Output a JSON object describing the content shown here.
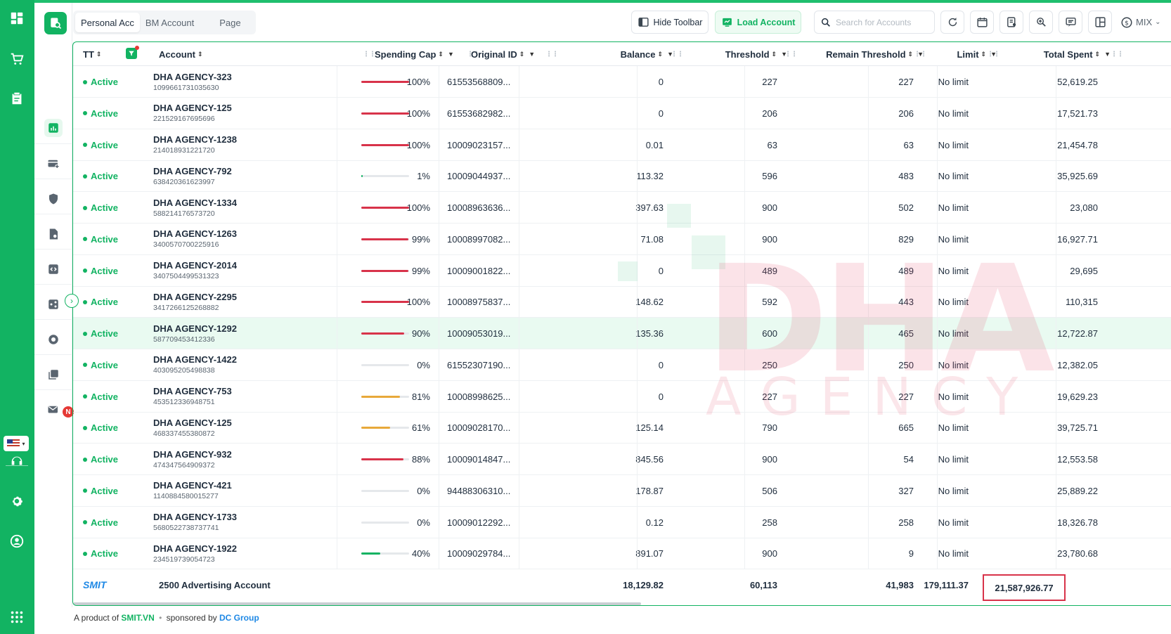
{
  "header": {
    "tabs": [
      "Personal Acc",
      "BM Account",
      "Page"
    ],
    "hide_toolbar": "Hide Toolbar",
    "load_account": "Load Account",
    "search_placeholder": "Search for Accounts",
    "currency": "MIX"
  },
  "columns": {
    "tt": "TT",
    "account": "Account",
    "spending_cap": "Spending Cap",
    "original_id": "Original ID",
    "balance": "Balance",
    "threshold": "Threshold",
    "remain_threshold": "Remain Threshold",
    "limit": "Limit",
    "total_spent": "Total Spent"
  },
  "colors": {
    "accent": "#12b362",
    "red": "#d8334a",
    "amber": "#e8a93a"
  },
  "rows": [
    {
      "status": "Active",
      "name": "DHA AGENCY-323",
      "id": "1099661731035630",
      "cap_pct": "100%",
      "cap_frac": 1.0,
      "cap_color": "red",
      "orig": "61553568809...",
      "balance": "0",
      "threshold": "227",
      "remain": "227",
      "limit": "No limit",
      "spent": "52,619.25"
    },
    {
      "status": "Active",
      "name": "DHA AGENCY-125",
      "id": "221529167695696",
      "cap_pct": "100%",
      "cap_frac": 1.0,
      "cap_color": "red",
      "orig": "61553682982...",
      "balance": "0",
      "threshold": "206",
      "remain": "206",
      "limit": "No limit",
      "spent": "17,521.73"
    },
    {
      "status": "Active",
      "name": "DHA AGENCY-1238",
      "id": "214018931221720",
      "cap_pct": "100%",
      "cap_frac": 1.0,
      "cap_color": "red",
      "orig": "10009023157...",
      "balance": "0.01",
      "threshold": "63",
      "remain": "63",
      "limit": "No limit",
      "spent": "21,454.78"
    },
    {
      "status": "Active",
      "name": "DHA AGENCY-792",
      "id": "638420361623997",
      "cap_pct": "1%",
      "cap_frac": 0.03,
      "cap_color": "green",
      "orig": "10009044937...",
      "balance": "113.32",
      "threshold": "596",
      "remain": "483",
      "limit": "No limit",
      "spent": "35,925.69"
    },
    {
      "status": "Active",
      "name": "DHA AGENCY-1334",
      "id": "588214176573720",
      "cap_pct": "100%",
      "cap_frac": 1.0,
      "cap_color": "red",
      "orig": "10008963636...",
      "balance": "397.63",
      "threshold": "900",
      "remain": "502",
      "limit": "No limit",
      "spent": "23,080"
    },
    {
      "status": "Active",
      "name": "DHA AGENCY-1263",
      "id": "3400570700225916",
      "cap_pct": "99%",
      "cap_frac": 0.99,
      "cap_color": "red",
      "orig": "10008997082...",
      "balance": "71.08",
      "threshold": "900",
      "remain": "829",
      "limit": "No limit",
      "spent": "16,927.71"
    },
    {
      "status": "Active",
      "name": "DHA AGENCY-2014",
      "id": "3407504499531323",
      "cap_pct": "99%",
      "cap_frac": 0.99,
      "cap_color": "red",
      "orig": "10009001822...",
      "balance": "0",
      "threshold": "489",
      "remain": "489",
      "limit": "No limit",
      "spent": "29,695"
    },
    {
      "status": "Active",
      "name": "DHA AGENCY-2295",
      "id": "3417266125268882",
      "cap_pct": "100%",
      "cap_frac": 1.0,
      "cap_color": "red",
      "orig": "10008975837...",
      "balance": "148.62",
      "threshold": "592",
      "remain": "443",
      "limit": "No limit",
      "spent": "110,315"
    },
    {
      "status": "Active",
      "name": "DHA AGENCY-1292",
      "id": "587709453412336",
      "cap_pct": "90%",
      "cap_frac": 0.9,
      "cap_color": "red",
      "orig": "10009053019...",
      "balance": "135.36",
      "threshold": "600",
      "remain": "465",
      "limit": "No limit",
      "spent": "12,722.87",
      "highlight": true
    },
    {
      "status": "Active",
      "name": "DHA AGENCY-1422",
      "id": "403095205498838",
      "cap_pct": "0%",
      "cap_frac": 0.0,
      "cap_color": "green",
      "orig": "61552307190...",
      "balance": "0",
      "threshold": "250",
      "remain": "250",
      "limit": "No limit",
      "spent": "12,382.05"
    },
    {
      "status": "Active",
      "name": "DHA AGENCY-753",
      "id": "453512336948751",
      "cap_pct": "81%",
      "cap_frac": 0.81,
      "cap_color": "amber",
      "orig": "10008998625...",
      "balance": "0",
      "threshold": "227",
      "remain": "227",
      "limit": "No limit",
      "spent": "19,629.23"
    },
    {
      "status": "Active",
      "name": "DHA AGENCY-125",
      "id": "468337455380872",
      "cap_pct": "61%",
      "cap_frac": 0.61,
      "cap_color": "amber",
      "orig": "10009028170...",
      "balance": "125.14",
      "threshold": "790",
      "remain": "665",
      "limit": "No limit",
      "spent": "39,725.71"
    },
    {
      "status": "Active",
      "name": "DHA AGENCY-932",
      "id": "474347564909372",
      "cap_pct": "88%",
      "cap_frac": 0.88,
      "cap_color": "red",
      "orig": "10009014847...",
      "balance": "845.56",
      "threshold": "900",
      "remain": "54",
      "limit": "No limit",
      "spent": "12,553.58"
    },
    {
      "status": "Active",
      "name": "DHA AGENCY-421",
      "id": "1140884580015277",
      "cap_pct": "0%",
      "cap_frac": 0.0,
      "cap_color": "green",
      "orig": "94488306310...",
      "balance": "178.87",
      "threshold": "506",
      "remain": "327",
      "limit": "No limit",
      "spent": "25,889.22"
    },
    {
      "status": "Active",
      "name": "DHA AGENCY-1733",
      "id": "5680522738737741",
      "cap_pct": "0%",
      "cap_frac": 0.0,
      "cap_color": "green",
      "orig": "10009012292...",
      "balance": "0.12",
      "threshold": "258",
      "remain": "258",
      "limit": "No limit",
      "spent": "18,326.78"
    },
    {
      "status": "Active",
      "name": "DHA AGENCY-1922",
      "id": "234519739054723",
      "cap_pct": "40%",
      "cap_frac": 0.4,
      "cap_color": "green",
      "orig": "10009029784...",
      "balance": "891.07",
      "threshold": "900",
      "remain": "9",
      "limit": "No limit",
      "spent": "23,780.68"
    }
  ],
  "footer": {
    "brand": "SMIT",
    "label": "2500 Advertising Account",
    "balance": "18,129.82",
    "threshold": "60,113",
    "remain": "41,983",
    "limit": "179,111.37",
    "spent": "21,587,926.77"
  },
  "watermark": {
    "main": "DHA",
    "sub": "AGENCY"
  },
  "credit": {
    "prefix": "A product of",
    "link1": "SMIT.VN",
    "sep": "•",
    "mid": "sponsored by",
    "link2": "DC Group"
  },
  "sidebar": {
    "badge": "N"
  }
}
